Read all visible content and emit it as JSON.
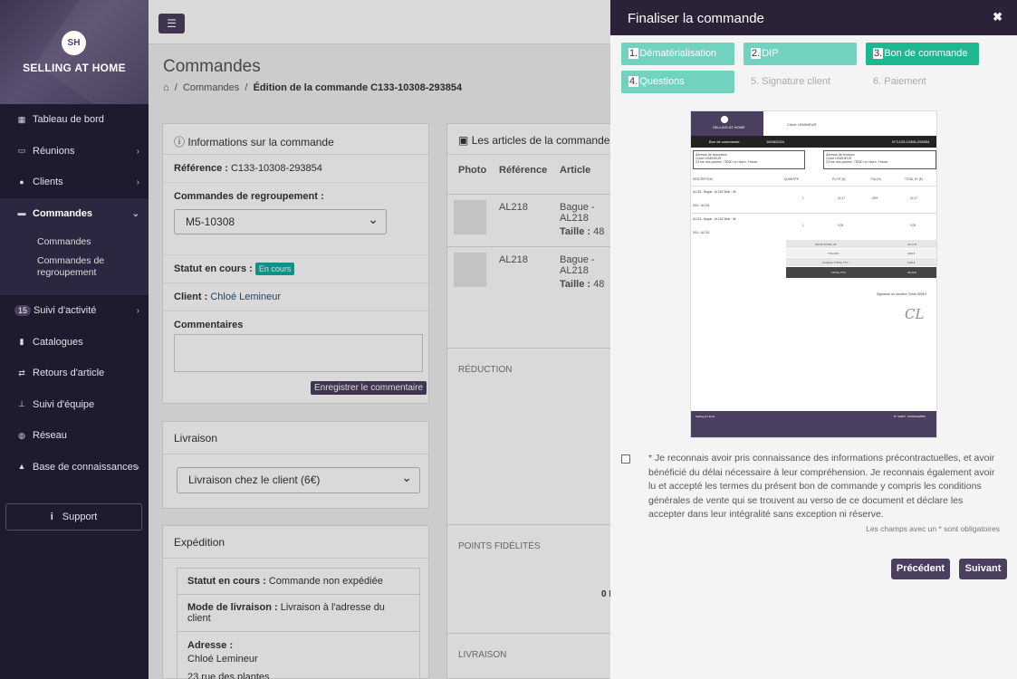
{
  "brand": {
    "logo_initials": "SH",
    "name": "SELLING AT HOME"
  },
  "sidebar": {
    "items": [
      {
        "label": "Tableau de bord",
        "icon": "dashboard-icon"
      },
      {
        "label": "Réunions",
        "icon": "calendar-icon"
      },
      {
        "label": "Clients",
        "icon": "users-icon"
      },
      {
        "label": "Commandes",
        "icon": "card-icon"
      },
      {
        "label": "Suivi d'activité",
        "icon": "activity-icon",
        "badge": "15"
      },
      {
        "label": "Catalogues",
        "icon": "book-icon"
      },
      {
        "label": "Retours d'article",
        "icon": "exchange-icon"
      },
      {
        "label": "Suivi d'équipe",
        "icon": "sitemap-icon"
      },
      {
        "label": "Réseau",
        "icon": "globe-icon"
      },
      {
        "label": "Base de connaissances",
        "icon": "graduation-icon"
      }
    ],
    "sub_items": [
      "Commandes",
      "Commandes de regroupement"
    ],
    "support": "Support"
  },
  "main": {
    "title": "Commandes",
    "breadcrumb": [
      "Commandes",
      "Édition de la commande C133-10308-293854"
    ],
    "info_panel": {
      "title": "Informations sur la commande",
      "reference_label": "Référence :",
      "reference_value": "C133-10308-293854",
      "regroup_label": "Commandes de regroupement :",
      "regroup_value": "M5-10308",
      "status_label": "Statut en cours :",
      "status_value": "En cours",
      "client_label": "Client :",
      "client_value": "Chloé Lemineur",
      "comments_label": "Commentaires",
      "save_comment": "Enregistrer le commentaire"
    },
    "delivery_panel": {
      "title": "Livraison",
      "option": "Livraison chez le client (6€)"
    },
    "shipping_panel": {
      "title": "Expédition",
      "status_label": "Statut en cours :",
      "status_value": "Commande non expédiée",
      "mode_label": "Mode de livraison :",
      "mode_value": "Livraison à l'adresse du client",
      "address_label": "Adresse :",
      "address_name": "Chloé Lemineur",
      "address_street": "23 rue des plantes"
    },
    "articles_panel": {
      "title": "Les articles de la commande",
      "headers": [
        "Photo",
        "Référence",
        "Article"
      ],
      "rows": [
        {
          "ref": "AL218",
          "article": "Bague - AL218",
          "size_label": "Taille :",
          "size": "48"
        },
        {
          "ref": "AL218",
          "article": "Bague - AL218",
          "size_label": "Taille :",
          "size": "48"
        }
      ],
      "reduction": "RÉDUCTION",
      "points": "POINTS FIDÉLITÉS",
      "livraison": "LIVRAISON",
      "partial": "0 I"
    }
  },
  "modal": {
    "title": "Finaliser la commande",
    "steps": [
      {
        "num": "1.",
        "label": "Dématérialisation",
        "state": "done"
      },
      {
        "num": "2.",
        "label": "DIP",
        "state": "done"
      },
      {
        "num": "3.",
        "label": "Bon de commande",
        "state": "current"
      },
      {
        "num": "4.",
        "label": "Questions",
        "state": "done"
      },
      {
        "num": "",
        "label": "5. Signature client",
        "state": "todo"
      },
      {
        "num": "",
        "label": "6. Paiement",
        "state": "todo"
      }
    ],
    "document": {
      "brand": "SELLING AT HOME",
      "bar_left": "Bon de commande",
      "bar_date": "16/08/2024",
      "bar_ref": "N°C133-10308-293854",
      "box1_title": "Adresse de facturation",
      "box2_title": "Adresse de livraison",
      "client": "Chloé LEMINEUR",
      "street": "23 rue des plantes, 75000 Le Havre, France",
      "columns": [
        "DESCRIPTION",
        "QUANTITÉ",
        "PU HT (€)",
        "TVA (%)",
        "TOTAL HT (€)"
      ],
      "lines": [
        {
          "desc": "AL218 - Bague - AL218 Taille : 48",
          "code": "SKU : AL218",
          "qty": "1",
          "pu": "24,17",
          "tva": "20%",
          "total": "24,17"
        },
        {
          "desc": "AL218 - Bague - AL218 Taille : 48",
          "code": "SKU : AL218",
          "qty": "1",
          "pu": "0,00",
          "tva": "",
          "total": "0,00"
        }
      ],
      "totals": [
        {
          "label": "SOUS-TOTAL HT",
          "value": "24,17 €"
        },
        {
          "label": "TVA 20%",
          "value": "4,83 €"
        },
        {
          "label": "Livraison TOTAL TTC",
          "value": "6,00 €"
        }
      ],
      "grand_total_label": "TOTAL TTC",
      "grand_total_value": "35,00 €",
      "signature_label": "Signature du vendeur Chloé DEMO",
      "signature": "CL",
      "footer_left": "Selling At Home",
      "footer_right": "N° SIRET : 823A0A02556"
    },
    "consent": "* Je reconnais avoir pris connaissance des informations précontractuelles, et avoir bénéficié du délai nécessaire à leur compréhension. Je reconnais également avoir lu et accepté les termes du présent bon de commande y compris les conditions générales de vente qui se trouvent au verso de ce document et déclare les accepter dans leur intégralité sans exception ni réserve.",
    "required_note": "Les champs avec un * sont obligatoires",
    "prev_button": "Précédent",
    "next_button": "Suivant",
    "close_icon": "close-icon"
  }
}
